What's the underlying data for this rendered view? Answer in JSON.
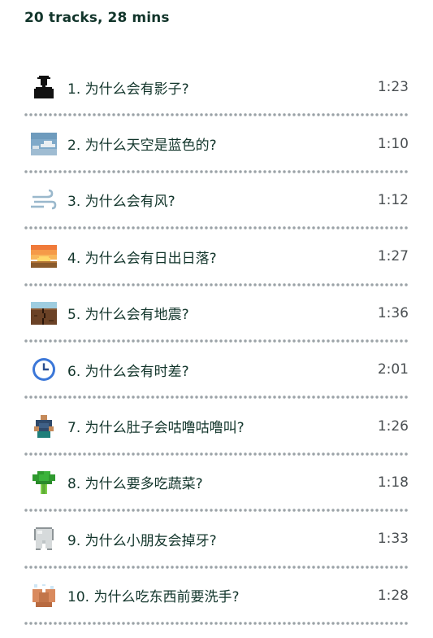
{
  "header": {
    "summary": "20 tracks, 28 mins"
  },
  "tracks": [
    {
      "number": "1.",
      "title": "为什么会有影子?",
      "duration": "1:23",
      "icon": "person-silhouette-icon"
    },
    {
      "number": "2.",
      "title": "为什么天空是蓝色的?",
      "duration": "1:10",
      "icon": "sky-cloud-icon"
    },
    {
      "number": "3.",
      "title": "为什么会有风?",
      "duration": "1:12",
      "icon": "wind-icon"
    },
    {
      "number": "4.",
      "title": "为什么会有日出日落?",
      "duration": "1:27",
      "icon": "sunset-icon"
    },
    {
      "number": "5.",
      "title": "为什么会有地震?",
      "duration": "1:36",
      "icon": "earthquake-icon"
    },
    {
      "number": "6.",
      "title": "为什么会有时差?",
      "duration": "2:01",
      "icon": "clock-icon"
    },
    {
      "number": "7.",
      "title": "为什么肚子会咕噜咕噜叫?",
      "duration": "1:26",
      "icon": "stomach-person-icon"
    },
    {
      "number": "8.",
      "title": "为什么要多吃蔬菜?",
      "duration": "1:18",
      "icon": "broccoli-icon"
    },
    {
      "number": "9.",
      "title": "为什么小朋友会掉牙?",
      "duration": "1:33",
      "icon": "tooth-icon"
    },
    {
      "number": "10.",
      "title": "为什么吃东西前要洗手?",
      "duration": "1:28",
      "icon": "washing-hands-icon"
    }
  ]
}
